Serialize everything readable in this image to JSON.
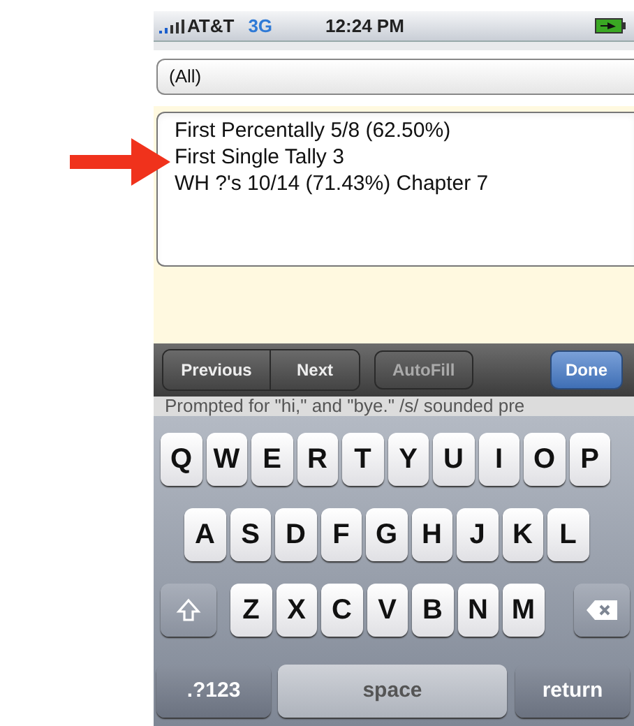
{
  "status_bar": {
    "carrier": "AT&T",
    "network": "3G",
    "time": "12:24 PM"
  },
  "filter": {
    "value": "(All)"
  },
  "list": {
    "items": [
      {
        "label": "First Percentally 5/8 (62.50%)"
      },
      {
        "label": "First Single Tally 3"
      },
      {
        "label": "WH ?'s 10/14 (71.43%) Chapter 7"
      }
    ]
  },
  "toolbar": {
    "buttons": [
      {
        "label": "Previous",
        "kind": "segment"
      },
      {
        "label": "Next",
        "kind": "segment"
      },
      {
        "label": "AutoFill",
        "kind": "plain"
      },
      {
        "label": "Done",
        "kind": "primary"
      }
    ]
  },
  "background_text": "Prompted for \"hi,\" and \"bye.\" /s/ sounded pre",
  "keyboard": {
    "rows": [
      [
        {
          "label": "Q",
          "kind": "letter"
        },
        {
          "label": "W",
          "kind": "letter"
        },
        {
          "label": "E",
          "kind": "letter"
        },
        {
          "label": "R",
          "kind": "letter"
        },
        {
          "label": "T",
          "kind": "letter"
        },
        {
          "label": "Y",
          "kind": "letter"
        },
        {
          "label": "U",
          "kind": "letter"
        },
        {
          "label": "I",
          "kind": "letter"
        },
        {
          "label": "O",
          "kind": "letter"
        },
        {
          "label": "P",
          "kind": "letter"
        }
      ],
      [
        {
          "label": "A",
          "kind": "letter"
        },
        {
          "label": "S",
          "kind": "letter"
        },
        {
          "label": "D",
          "kind": "letter"
        },
        {
          "label": "F",
          "kind": "letter"
        },
        {
          "label": "G",
          "kind": "letter"
        },
        {
          "label": "H",
          "kind": "letter"
        },
        {
          "label": "J",
          "kind": "letter"
        },
        {
          "label": "K",
          "kind": "letter"
        },
        {
          "label": "L",
          "kind": "letter"
        }
      ],
      [
        {
          "kind": "shift"
        },
        {
          "label": "Z",
          "kind": "letter"
        },
        {
          "label": "X",
          "kind": "letter"
        },
        {
          "label": "C",
          "kind": "letter"
        },
        {
          "label": "V",
          "kind": "letter"
        },
        {
          "label": "B",
          "kind": "letter"
        },
        {
          "label": "N",
          "kind": "letter"
        },
        {
          "label": "M",
          "kind": "letter"
        },
        {
          "kind": "delete"
        }
      ]
    ],
    "bottom_keys": [
      {
        "label": ".?123",
        "kind": "mode"
      },
      {
        "label": "space",
        "kind": "space"
      },
      {
        "label": "return",
        "kind": "return"
      }
    ]
  }
}
